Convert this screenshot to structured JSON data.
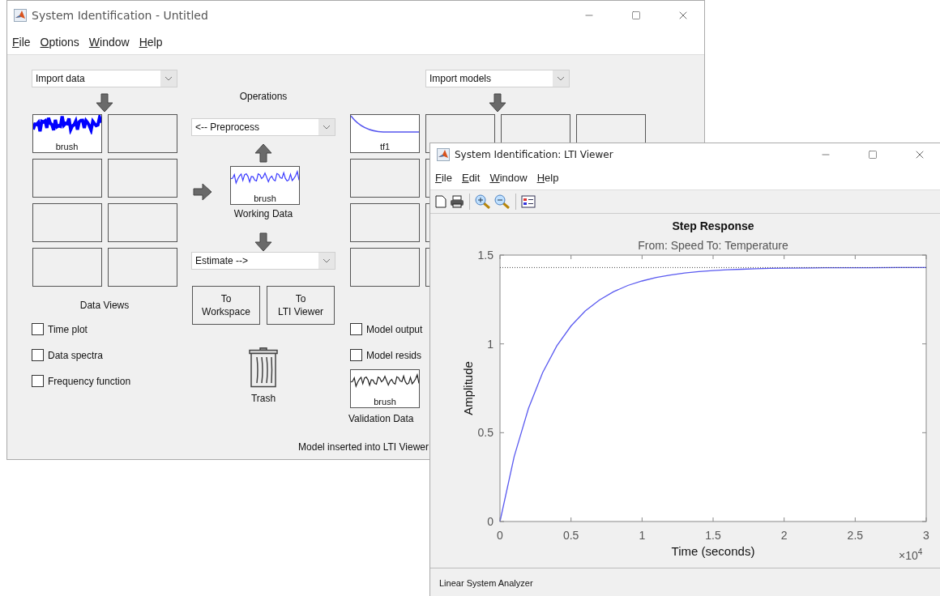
{
  "main_window": {
    "title": "System Identification - Untitled",
    "menu": [
      "File",
      "Options",
      "Window",
      "Help"
    ],
    "data_panel": {
      "import": "Import data",
      "slots": [
        [
          {
            "kind": "bold-wave",
            "label": "brush",
            "color": "#0000ff"
          },
          {
            "kind": "empty"
          }
        ],
        [
          {
            "kind": "empty"
          },
          {
            "kind": "empty"
          }
        ],
        [
          {
            "kind": "empty"
          },
          {
            "kind": "empty"
          }
        ],
        [
          {
            "kind": "empty"
          },
          {
            "kind": "empty"
          }
        ]
      ],
      "views_title": "Data Views",
      "views": [
        {
          "label": "Time plot",
          "checked": false
        },
        {
          "label": "Data spectra",
          "checked": false
        },
        {
          "label": "Frequency function",
          "checked": false
        }
      ]
    },
    "operations": {
      "title": "Operations",
      "preprocess": "<-- Preprocess",
      "working_data": {
        "kind": "wave",
        "label": "brush",
        "color": "#3a3aff"
      },
      "working_data_caption": "Working Data",
      "estimate": "Estimate -->",
      "buttons": [
        "To\nWorkspace",
        "To\nLTI Viewer"
      ],
      "trash": "Trash"
    },
    "model_panel": {
      "import": "Import models",
      "slots": [
        [
          {
            "kind": "decay",
            "label": "tf1",
            "color": "#5555ee"
          },
          {
            "kind": "empty"
          },
          {
            "kind": "empty"
          },
          {
            "kind": "empty"
          }
        ],
        [
          {
            "kind": "empty"
          },
          {
            "kind": "empty"
          }
        ],
        [
          {
            "kind": "empty"
          },
          {
            "kind": "empty"
          }
        ],
        [
          {
            "kind": "empty"
          },
          {
            "kind": "empty"
          }
        ]
      ],
      "views": [
        {
          "label": "Model output",
          "checked": false
        },
        {
          "label": "Model resids",
          "checked": false
        }
      ],
      "validation_data": {
        "kind": "wave",
        "label": "brush",
        "color": "#222222"
      },
      "validation_caption": "Validation Data"
    },
    "status": "Model inserted into LTI Viewer"
  },
  "viewer_window": {
    "title": "System Identification: LTI Viewer",
    "menu": [
      "File",
      "Edit",
      "Window",
      "Help"
    ],
    "subtitle": "From: Speed  To: Temperature",
    "x_multiplier": {
      "base": "×10",
      "exponent": "4"
    },
    "chart_data": {
      "type": "line",
      "title": "Step Response",
      "xlabel": "Time (seconds)",
      "ylabel": "Amplitude",
      "x": [
        0,
        0.1,
        0.2,
        0.3,
        0.4,
        0.5,
        0.6,
        0.7,
        0.8,
        0.9,
        1.0,
        1.1,
        1.2,
        1.3,
        1.4,
        1.5,
        1.6,
        1.7,
        1.8,
        1.9,
        2.0,
        2.2,
        2.4,
        2.6,
        2.8,
        3.0
      ],
      "series": [
        {
          "color": "#5a5af0",
          "values": [
            0,
            0.365,
            0.636,
            0.838,
            0.989,
            1.101,
            1.185,
            1.247,
            1.294,
            1.329,
            1.354,
            1.374,
            1.388,
            1.399,
            1.407,
            1.413,
            1.417,
            1.42,
            1.423,
            1.425,
            1.426,
            1.428,
            1.429,
            1.429,
            1.43,
            1.43
          ]
        },
        {
          "color": "#444444",
          "line_style": "dotted",
          "values": [
            1.43,
            1.43,
            1.43,
            1.43,
            1.43,
            1.43,
            1.43,
            1.43,
            1.43,
            1.43,
            1.43,
            1.43,
            1.43,
            1.43,
            1.43,
            1.43,
            1.43,
            1.43,
            1.43,
            1.43,
            1.43,
            1.43,
            1.43,
            1.43,
            1.43,
            1.43
          ]
        }
      ],
      "xlim": [
        0,
        3
      ],
      "ylim": [
        0,
        1.5
      ],
      "xticks": [
        0,
        0.5,
        1,
        1.5,
        2,
        2.5,
        3
      ],
      "yticks": [
        0,
        0.5,
        1,
        1.5
      ]
    },
    "status": "Linear System Analyzer"
  }
}
